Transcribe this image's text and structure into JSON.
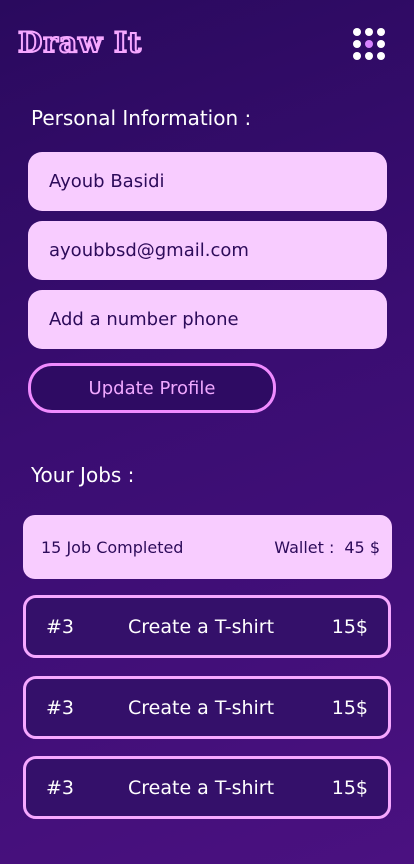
{
  "app": {
    "logo_text": "Draw It"
  },
  "personal": {
    "title": "Personal Information :",
    "name": "Ayoub Basidi",
    "email": "ayoubbsd@gmail.com",
    "phone_placeholder": "Add a number phone",
    "update_label": "Update Profile"
  },
  "jobs": {
    "title": "Your Jobs :",
    "completed": "15 Job Completed",
    "wallet_label": "Wallet :",
    "wallet_value": "45 $",
    "items": [
      {
        "id": "#3",
        "title": "Create a T-shirt",
        "price": "15$"
      },
      {
        "id": "#3",
        "title": "Create a T-shirt",
        "price": "15$"
      },
      {
        "id": "#3",
        "title": "Create a T-shirt",
        "price": "15$"
      }
    ]
  },
  "colors": {
    "background": "#3a0d72",
    "field_bg": "#f8ccff",
    "accent": "#f08bff",
    "text_dark": "#2d0b5a"
  },
  "icons": {
    "menu": "grid-menu-icon"
  }
}
